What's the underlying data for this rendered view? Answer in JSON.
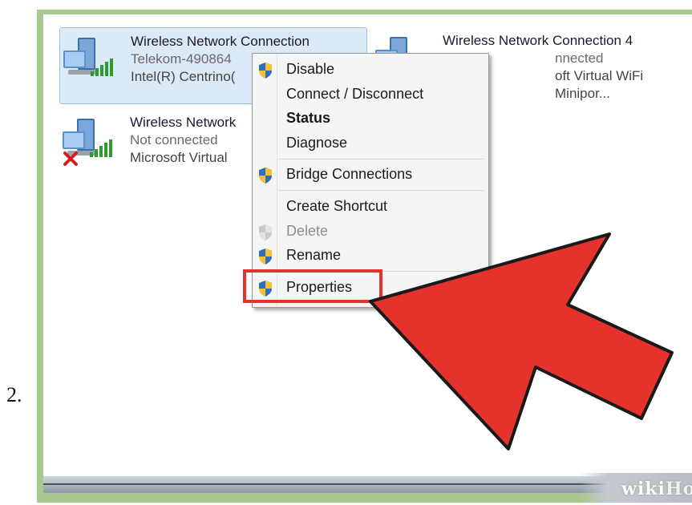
{
  "step_number": "2.",
  "connections": [
    {
      "name": "Wireless Network Connection",
      "status": "Telekom-490864",
      "device": "Intel(R) Centrino(",
      "selected": true
    },
    {
      "name": "Wireless Network Connection 4",
      "status": "nnected",
      "device": "oft Virtual WiFi Minipor..."
    },
    {
      "name": "Wireless Network",
      "status": "Not connected",
      "device": "Microsoft Virtual"
    }
  ],
  "context_menu": {
    "items": [
      {
        "label": "Disable",
        "shield": true
      },
      {
        "label": "Connect / Disconnect"
      },
      {
        "label": "Status",
        "bold": true
      },
      {
        "label": "Diagnose"
      },
      {
        "label": "Bridge Connections",
        "shield": true
      },
      {
        "label": "Create Shortcut"
      },
      {
        "label": "Delete",
        "shield": true,
        "disabled": true
      },
      {
        "label": "Rename",
        "shield": true
      },
      {
        "label": "Properties",
        "shield": true,
        "highlighted": true
      }
    ]
  },
  "watermark": {
    "wiki": "wiki",
    "how": "How"
  },
  "colors": {
    "frame": "#a8c88f",
    "highlight": "#e5322d",
    "arrow": "#e5322d",
    "selection": "#dce9f7"
  },
  "icons": {
    "network": "network-adapter-icon",
    "signal": "signal-bars-icon",
    "error": "red-x-icon",
    "shield": "uac-shield-icon"
  }
}
